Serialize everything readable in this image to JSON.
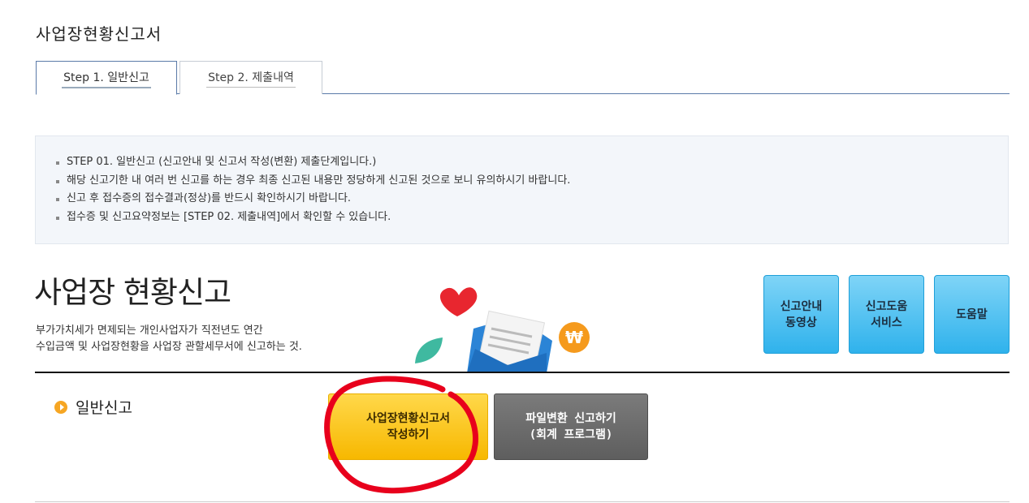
{
  "page": {
    "title": "사업장현황신고서"
  },
  "tabs": [
    {
      "label": "Step 1. 일반신고",
      "active": true
    },
    {
      "label": "Step 2. 제출내역",
      "active": false
    }
  ],
  "notice": {
    "items": [
      "STEP 01. 일반신고 (신고안내 및 신고서 작성(변환) 제출단계입니다.)",
      "해당 신고기한 내 여러 번 신고를 하는 경우 최종 신고된 내용만 정당하게 신고된 것으로 보니 유의하시기 바랍니다.",
      "신고 후 접수증의 접수결과(정상)를 반드시 확인하시기 바랍니다.",
      "접수증 및 신고요약정보는 [STEP 02. 제출내역]에서 확인할 수 있습니다."
    ]
  },
  "hero": {
    "title": "사업장 현황신고",
    "desc_line1": "부가가치세가 면제되는 개인사업자가 직전년도 연간",
    "desc_line2": "수입금액 및 사업장현황을 사업장 관할세무서에 신고하는 것."
  },
  "help_buttons": [
    {
      "label": "신고안내\n동영상"
    },
    {
      "label": "신고도움\n서비스"
    },
    {
      "label": "도움말"
    }
  ],
  "section": {
    "label": "일반신고"
  },
  "actions": {
    "write_label": "사업장현황신고서\n작성하기",
    "convert_label": "파일변환 신고하기\n(회계 프로그램)"
  },
  "colors": {
    "accent_yellow": "#f7b800",
    "accent_blue": "#2fb2ec",
    "annotation_red": "#e8001c",
    "tab_border": "#5a7aa8"
  },
  "icons": [
    "heart-icon",
    "leaf-icon",
    "envelope-icon",
    "won-coin-icon",
    "arrow-bullet-icon"
  ]
}
